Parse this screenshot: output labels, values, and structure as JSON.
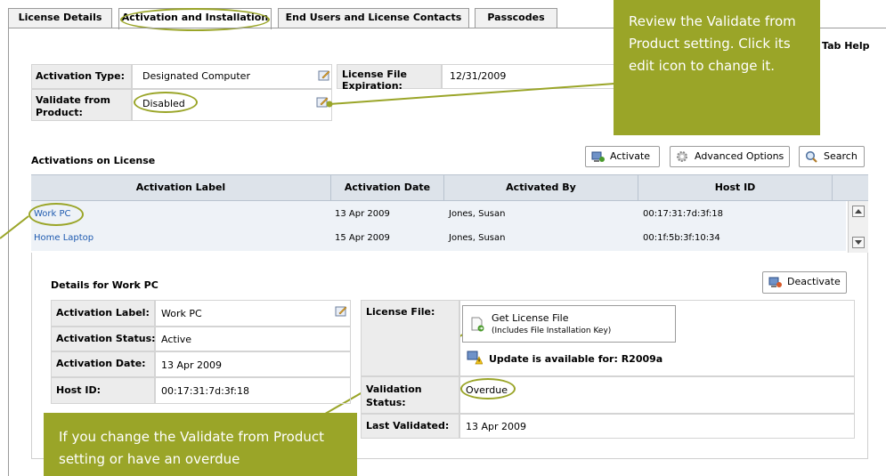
{
  "tabs": [
    {
      "label": "License Details"
    },
    {
      "label": "Activation and Installation"
    },
    {
      "label": "End Users and License Contacts"
    },
    {
      "label": "Passcodes"
    }
  ],
  "tab_help": "Tab Help",
  "license_info": {
    "activation_type_label": "Activation Type:",
    "activation_type_value": "Designated Computer",
    "validate_label": "Validate from Product:",
    "validate_value": "Disabled",
    "expiration_label": "License File Expiration:",
    "expiration_value": "12/31/2009"
  },
  "activations": {
    "title": "Activations on License",
    "activate_label": "Activate",
    "advanced_label": "Advanced Options",
    "search_label": "Search",
    "columns": [
      "Activation Label",
      "Activation Date",
      "Activated By",
      "Host ID"
    ],
    "rows": [
      {
        "label": "Work PC",
        "date": "13 Apr 2009",
        "by": "Jones, Susan",
        "host": "00:17:31:7d:3f:18"
      },
      {
        "label": "Home Laptop",
        "date": "15 Apr 2009",
        "by": "Jones, Susan",
        "host": "00:1f:5b:3f:10:34"
      }
    ]
  },
  "details": {
    "title": "Details for Work PC",
    "deactivate_label": "Deactivate",
    "fields": [
      {
        "label": "Activation Label:",
        "value": "Work PC"
      },
      {
        "label": "Activation Status:",
        "value": "Active"
      },
      {
        "label": "Activation Date:",
        "value": "13 Apr 2009"
      },
      {
        "label": "Host ID:",
        "value": "00:17:31:7d:3f:18"
      }
    ],
    "license_file_label": "License File:",
    "get_license_title": "Get License File",
    "get_license_sub": "(Includes File Installation Key)",
    "update_text": "Update is available for: R2009a",
    "validation_status_label": "Validation Status:",
    "validation_status_value": "Overdue",
    "last_validated_label": "Last Validated:",
    "last_validated_value": "13 Apr 2009"
  },
  "callouts": {
    "top": "Review the Validate from Product setting. Click its edit icon to change it.",
    "bottom": "If you change the Validate from Product setting or have an overdue"
  },
  "colors": {
    "callout": "#9aa528",
    "link": "#1f5bb0",
    "grid_header": "#dde3ea"
  }
}
